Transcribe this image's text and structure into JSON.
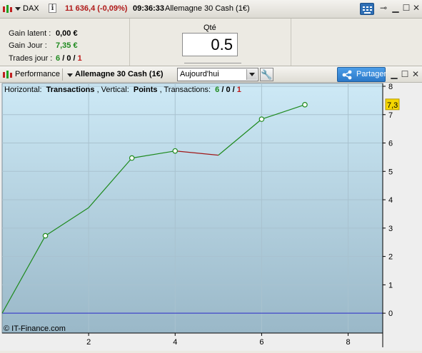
{
  "topbar": {
    "instrument": "DAX",
    "info_icon": "i",
    "price_change": "11 636,4 (-0,09%)",
    "time": "09:36:33",
    "market": "Allemagne 30 Cash (1€)",
    "colors": {
      "price_change": "#b01818"
    }
  },
  "stats": {
    "gain_latent_label": "Gain latent :",
    "gain_latent_value": "0,00 €",
    "gain_jour_label": "Gain Jour :",
    "gain_jour_value": "7,35 €",
    "trades_label": "Trades jour :",
    "trades_win": "6",
    "trades_sep1": "/",
    "trades_neutral": "0",
    "trades_sep2": "/",
    "trades_loss": "1",
    "colors": {
      "gain": "#1e8a1e",
      "loss": "#c01818"
    }
  },
  "order": {
    "qty_label": "Qté",
    "qty_value": "0.5"
  },
  "panel_bar": {
    "performance_label": "Performance",
    "market_label": "Allemagne 30 Cash (1€)",
    "period_selected": "Aujourd'hui",
    "share_label": "Partager"
  },
  "chart_header": {
    "h_label": "Horizontal:",
    "h_value": "Transactions",
    "v_label": ", Vertical:",
    "v_value": "Points",
    "t_label": ", Transactions:",
    "t_win": "6",
    "t_sep1": " / ",
    "t_neutral": "0",
    "t_sep2": " / ",
    "t_loss": "1"
  },
  "watermark": "© IT-Finance.com",
  "chart_data": {
    "type": "line",
    "title": "",
    "xlabel": "Transactions",
    "ylabel": "Points",
    "xlim": [
      0,
      8.8
    ],
    "ylim": [
      -0.7,
      8.1
    ],
    "x_ticks": [
      2,
      4,
      6,
      8
    ],
    "y_ticks": [
      0,
      1,
      2,
      3,
      4,
      5,
      6,
      7,
      8
    ],
    "current_value_label": "7,3",
    "series": [
      {
        "x": [
          0,
          1,
          2,
          3,
          4,
          5,
          6,
          7
        ],
        "y": [
          0,
          2.73,
          3.72,
          5.47,
          5.72,
          5.57,
          6.84,
          7.35
        ],
        "markers": [
          false,
          true,
          false,
          true,
          true,
          false,
          true,
          true
        ],
        "segment_colors": [
          "#1e8a1e",
          "#1e8a1e",
          "#1e8a1e",
          "#1e8a1e",
          "#a01818",
          "#1e8a1e",
          "#1e8a1e"
        ]
      }
    ],
    "baseline": {
      "y": 0,
      "color": "#2828c8"
    },
    "grid": true,
    "colors": {
      "background_top": "#cde9f6",
      "background_bottom": "#9ab8c8",
      "axis": "#000000",
      "marker_fill": "#ffffff",
      "current_value_bg": "#f5d600"
    }
  }
}
